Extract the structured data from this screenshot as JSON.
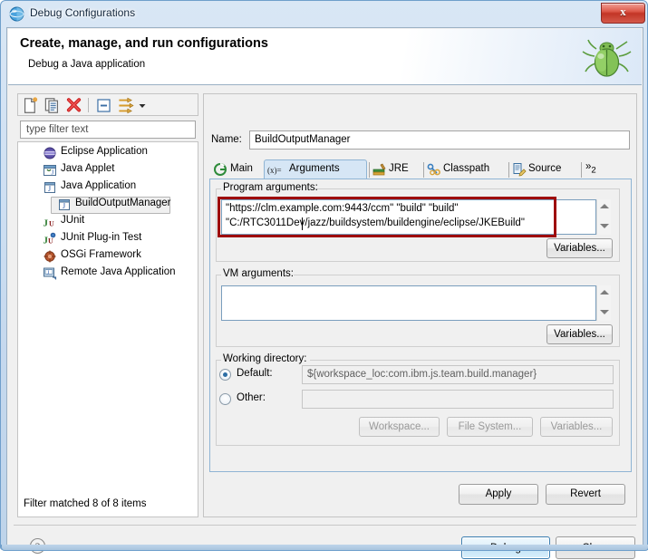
{
  "window": {
    "title": "Debug Configurations",
    "title_icon": "debug-perspective-icon",
    "close_glyph": "x"
  },
  "header": {
    "title": "Create, manage, and run configurations",
    "subtitle": "Debug a Java application",
    "banner_icon": "green-bug-icon"
  },
  "left_panel": {
    "toolbar": [
      {
        "name": "new-launch-configuration",
        "icon": "new-document-icon"
      },
      {
        "name": "duplicate-launch-configuration",
        "icon": "copy-pages-icon"
      },
      {
        "name": "delete-launch-configuration",
        "icon": "red-x-delete-icon"
      },
      {
        "name": "collapse-all",
        "icon": "collapse-all-icon"
      },
      {
        "name": "filter-launch-configurations",
        "icon": "filter-arrows-icon"
      },
      {
        "name": "view-menu",
        "icon": "chevron-down-icon"
      }
    ],
    "filter": {
      "value": "",
      "placeholder": "type filter text"
    },
    "tree": [
      {
        "label": "Eclipse Application",
        "icon": "eclipse-sphere-icon",
        "indent": 0,
        "selected": false
      },
      {
        "label": "Java Applet",
        "icon": "java-applet-icon",
        "indent": 0,
        "selected": false
      },
      {
        "label": "Java Application",
        "icon": "java-application-icon",
        "indent": 0,
        "selected": false
      },
      {
        "label": "BuildOutputManager",
        "icon": "java-application-icon",
        "indent": 1,
        "selected": true
      },
      {
        "label": "JUnit",
        "icon": "junit-icon",
        "indent": 0,
        "selected": false
      },
      {
        "label": "JUnit Plug-in Test",
        "icon": "junit-plugin-icon",
        "indent": 0,
        "selected": false
      },
      {
        "label": "OSGi Framework",
        "icon": "osgi-icon",
        "indent": 0,
        "selected": false
      },
      {
        "label": "Remote Java Application",
        "icon": "remote-java-icon",
        "indent": 0,
        "selected": false
      }
    ],
    "status": "Filter matched 8 of 8 items"
  },
  "right_panel": {
    "name_label": "Name:",
    "name_value": "BuildOutputManager",
    "tabs": [
      {
        "label": "Main",
        "icon": "main-tab-icon",
        "selected": false
      },
      {
        "label": "Arguments",
        "icon": "arguments-variable-icon",
        "selected": true
      },
      {
        "label": "JRE",
        "icon": "jre-books-icon",
        "selected": false
      },
      {
        "label": "Classpath",
        "icon": "classpath-icon",
        "selected": false
      },
      {
        "label": "Source",
        "icon": "source-icon",
        "selected": false
      }
    ],
    "tab_overflow": "2",
    "program_arguments": {
      "title": "Program arguments:",
      "lines": [
        "\"https://clm.example.com:9443/ccm\" \"build\" \"build\"",
        "\"C:/RTC3011Dev/jazz/buildsystem/buildengine/eclipse/JKEBuild\""
      ],
      "variables_button": "Variables...",
      "highlighted": true,
      "highlight_color": "#9e0b0b"
    },
    "vm_arguments": {
      "title": "VM arguments:",
      "lines": [],
      "variables_button": "Variables..."
    },
    "working_directory": {
      "title": "Working directory:",
      "default_label": "Default:",
      "default_selected": true,
      "default_value": "${workspace_loc:com.ibm.js.team.build.manager}",
      "other_label": "Other:",
      "other_selected": false,
      "other_value": "",
      "buttons": [
        {
          "label": "Workspace...",
          "enabled": false
        },
        {
          "label": "File System...",
          "enabled": false
        },
        {
          "label": "Variables...",
          "enabled": false
        }
      ]
    },
    "apply_button": "Apply",
    "revert_button": "Revert"
  },
  "footer": {
    "help_icon": "help-question-icon",
    "debug_button": "Debug",
    "close_button": "Close"
  }
}
